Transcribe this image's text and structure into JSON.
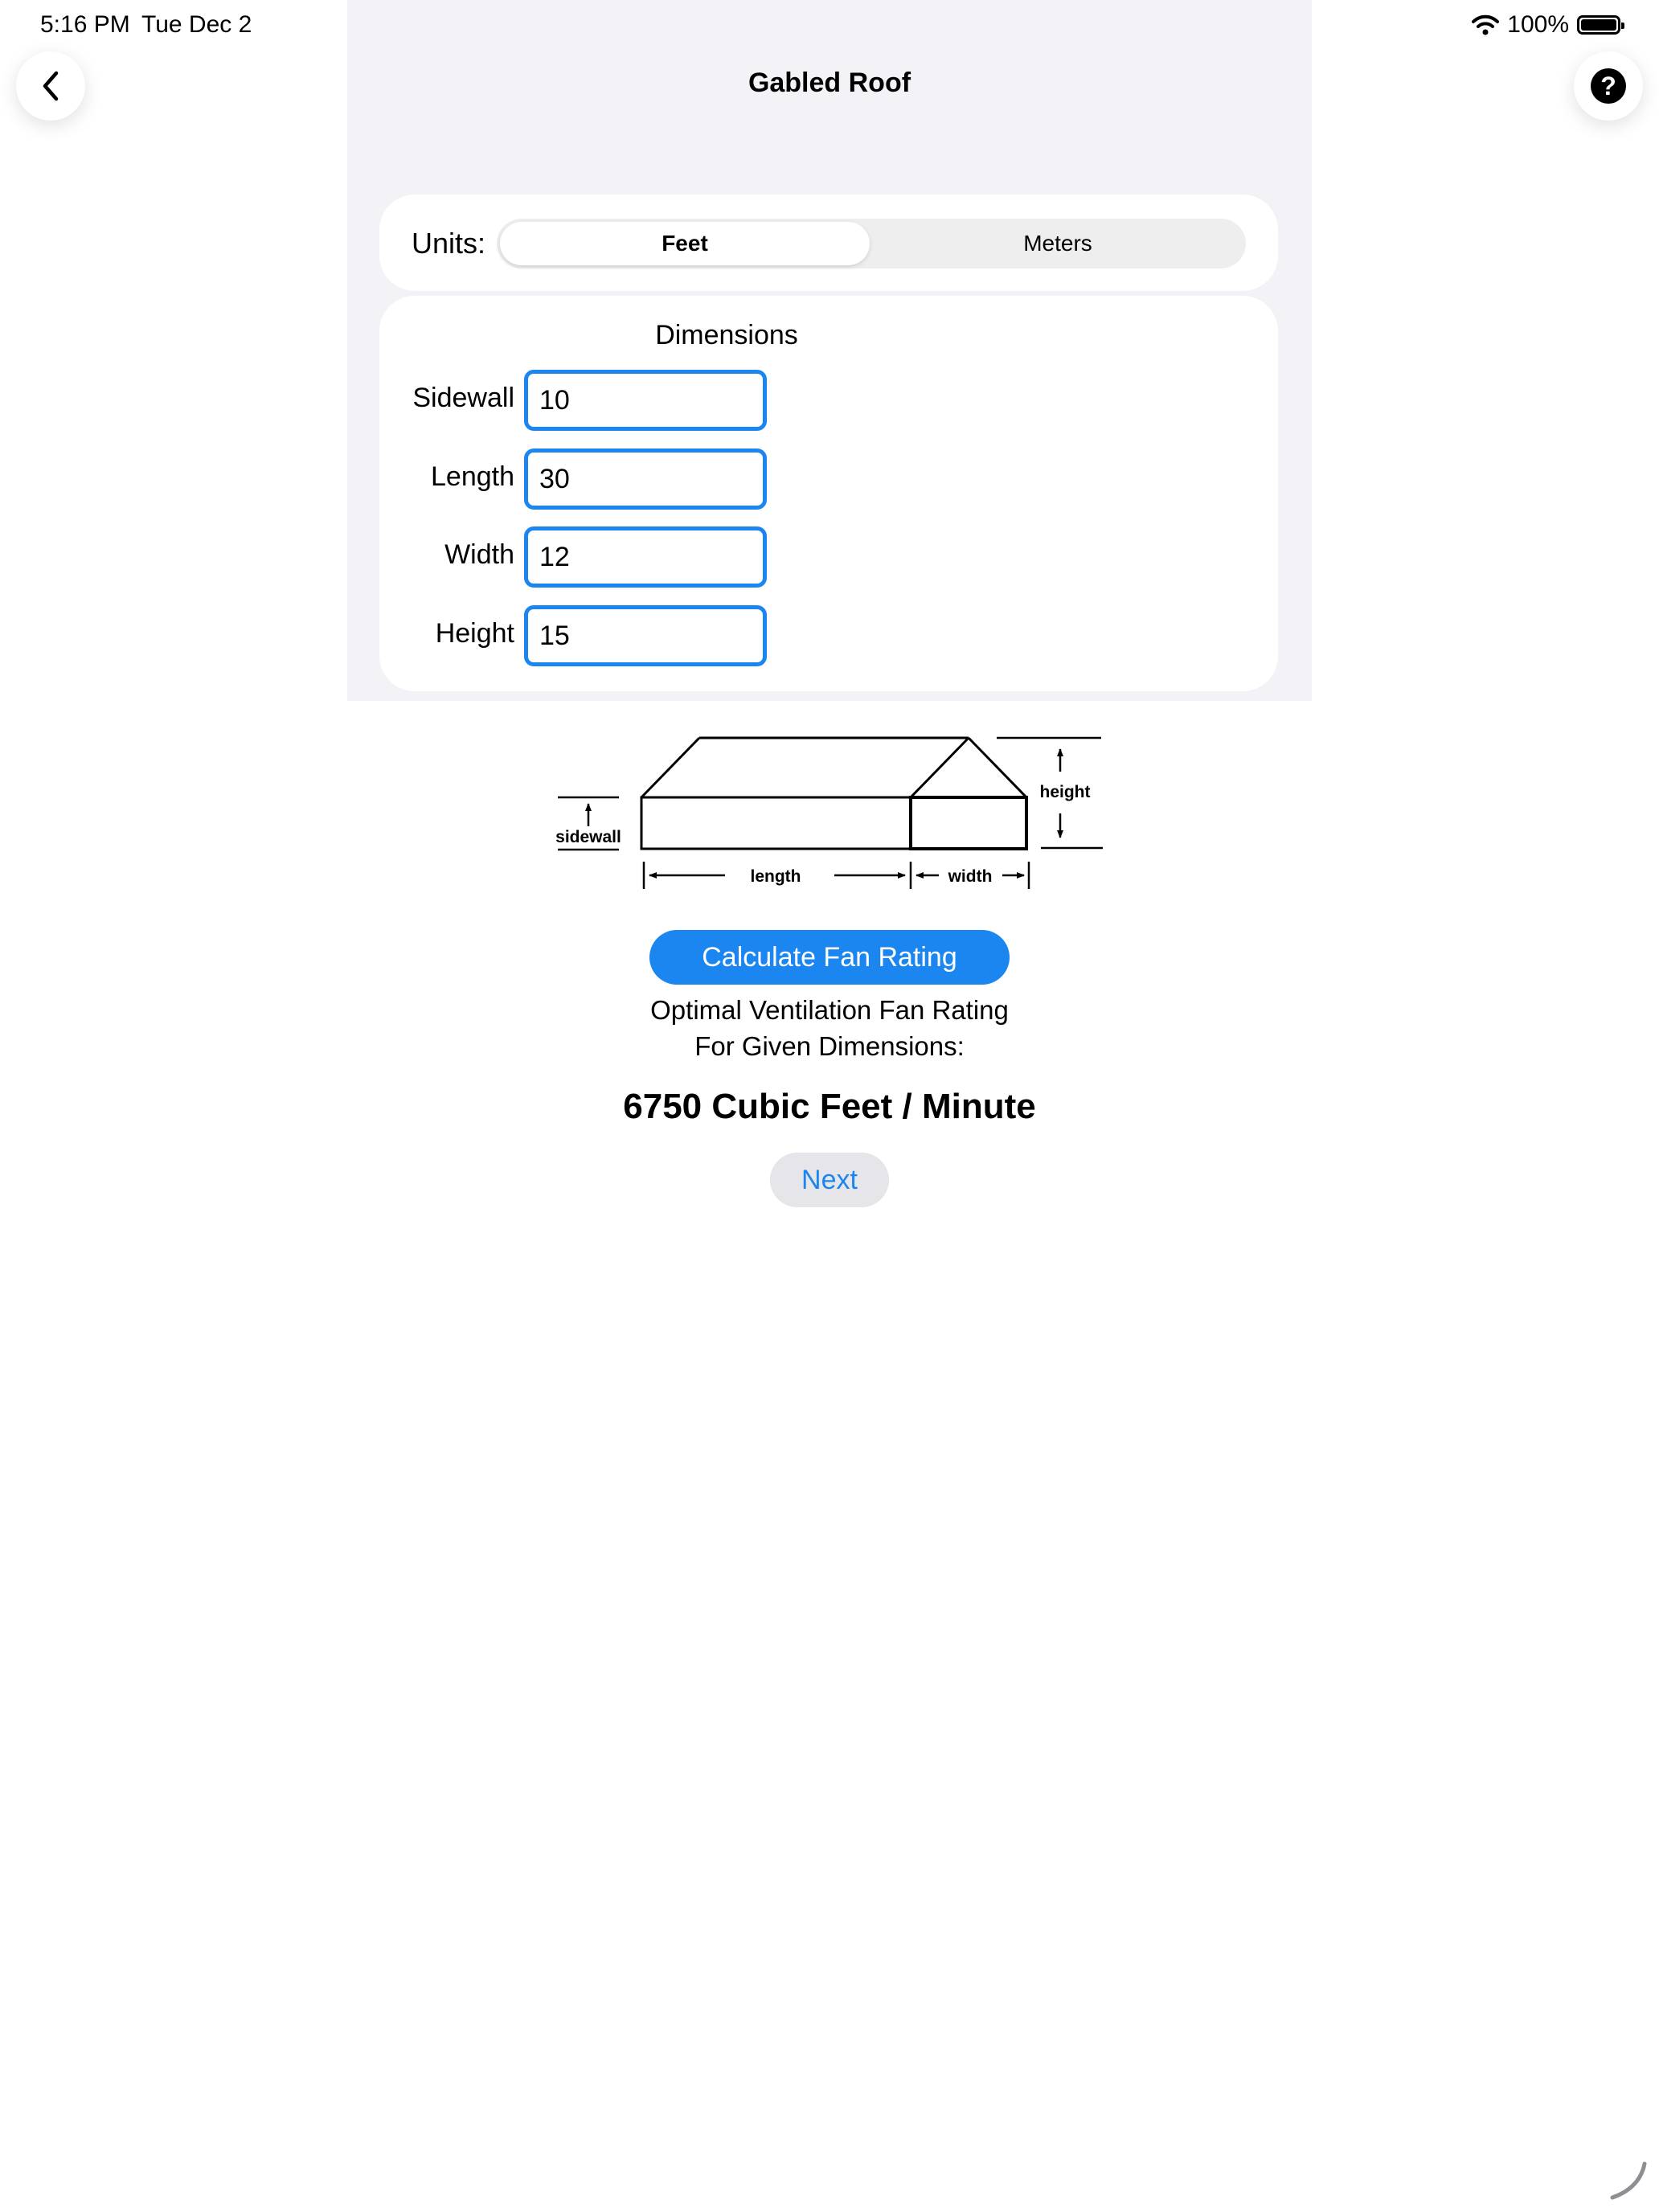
{
  "status_bar": {
    "time": "5:16 PM",
    "date": "Tue Dec 2",
    "battery": "100%"
  },
  "nav": {
    "title": "Gabled Roof",
    "back_icon": "chevron-left-icon",
    "help_icon": "question-circle-icon",
    "help_glyph": "?"
  },
  "units": {
    "label": "Units:",
    "options": [
      "Feet",
      "Meters"
    ],
    "selected": "Feet"
  },
  "dimensions": {
    "header": "Dimensions",
    "fields": [
      {
        "label": "Sidewall",
        "value": "10"
      },
      {
        "label": "Length",
        "value": "30"
      },
      {
        "label": "Width",
        "value": "12"
      },
      {
        "label": "Height",
        "value": "15"
      }
    ]
  },
  "diagram": {
    "labels": {
      "sidewall": "sidewall",
      "length": "length",
      "width": "width",
      "height": "height"
    }
  },
  "actions": {
    "calculate_label": "Calculate Fan Rating",
    "next_label": "Next"
  },
  "result": {
    "line1": "Optimal Ventilation Fan Rating",
    "line2": "For Given Dimensions:",
    "value": "6750 Cubic Feet / Minute"
  },
  "colors": {
    "accent": "#1b86f0",
    "panel_bg": "#f2f2f7",
    "next_bg": "#e5e5ea"
  }
}
